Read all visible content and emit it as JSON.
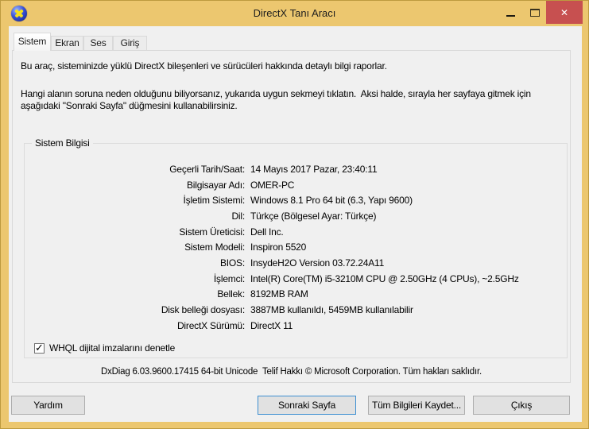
{
  "window": {
    "title": "DirectX Tanı Aracı"
  },
  "icons": {
    "directx": "yellow-x-on-blue-sphere",
    "minimize": "–",
    "maximize": "▢",
    "close": "✕",
    "check": "✓"
  },
  "colors": {
    "window_gold": "#ecc76f",
    "close_red": "#c75050",
    "dialog_bg": "#f0f0f0",
    "default_button_border": "#3d8fd1"
  },
  "tabs": [
    {
      "label": "Sistem",
      "active": true
    },
    {
      "label": "Ekran",
      "active": false
    },
    {
      "label": "Ses",
      "active": false
    },
    {
      "label": "Giriş",
      "active": false
    }
  ],
  "intro": {
    "paragraph1": "Bu araç, sisteminizde yüklü DirectX bileşenleri ve sürücüleri hakkında detaylı bilgi raporlar.",
    "paragraph2": "Hangi alanın soruna neden olduğunu biliyorsanız, yukarıda uygun sekmeyi tıklatın.  Aksi halde, sırayla her sayfaya gitmek için aşağıdaki \"Sonraki Sayfa\" düğmesini kullanabilirsiniz."
  },
  "system_info": {
    "group_title": "Sistem Bilgisi",
    "rows": [
      {
        "label": "Geçerli Tarih/Saat:",
        "value": "14 Mayıs 2017 Pazar, 23:40:11"
      },
      {
        "label": "Bilgisayar Adı:",
        "value": "OMER-PC"
      },
      {
        "label": "İşletim Sistemi:",
        "value": "Windows 8.1 Pro 64 bit (6.3, Yapı 9600)"
      },
      {
        "label": "Dil:",
        "value": "Türkçe (Bölgesel Ayar: Türkçe)"
      },
      {
        "label": "Sistem Üreticisi:",
        "value": "Dell Inc."
      },
      {
        "label": "Sistem Modeli:",
        "value": "Inspiron 5520"
      },
      {
        "label": "BIOS:",
        "value": "InsydeH2O Version 03.72.24A11"
      },
      {
        "label": "İşlemci:",
        "value": "Intel(R) Core(TM) i5-3210M CPU @ 2.50GHz (4 CPUs), ~2.5GHz"
      },
      {
        "label": "Bellek:",
        "value": "8192MB RAM"
      },
      {
        "label": "Disk belleği dosyası:",
        "value": "3887MB kullanıldı, 5459MB kullanılabilir"
      },
      {
        "label": "DirectX Sürümü:",
        "value": "DirectX 11"
      }
    ],
    "whql_checkbox": {
      "label": "WHQL dijital imzalarını denetle",
      "checked": true
    }
  },
  "status_line": "DxDiag 6.03.9600.17415 64-bit Unicode  Telif Hakkı © Microsoft Corporation. Tüm hakları saklıdır.",
  "buttons": {
    "help": "Yardım",
    "next_page": "Sonraki Sayfa",
    "save_all": "Tüm Bilgileri Kaydet...",
    "exit": "Çıkış"
  }
}
